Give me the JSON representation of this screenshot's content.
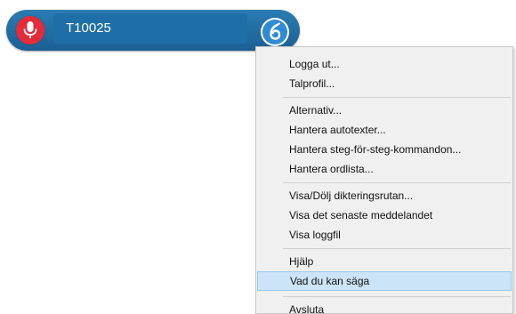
{
  "dictation_bar": {
    "user_name": "T10025",
    "mic_icon": "microphone-icon",
    "menu_icon": "dragon-logo-icon",
    "colors": {
      "bar": "#1e6fa8",
      "mic": "#e52b3a",
      "menu_button": "#2f8bd3"
    }
  },
  "menu": {
    "items": [
      {
        "label": "Logga ut..."
      },
      {
        "label": "Talprofil..."
      },
      {
        "label": "Alternativ..."
      },
      {
        "label": "Hantera autotexter..."
      },
      {
        "label": "Hantera steg-för-steg-kommandon..."
      },
      {
        "label": "Hantera ordlista..."
      },
      {
        "label": "Visa/Dölj dikteringsrutan..."
      },
      {
        "label": "Visa det senaste meddelandet"
      },
      {
        "label": "Visa loggfil"
      },
      {
        "label": "Hjälp"
      },
      {
        "label": "Vad du kan säga",
        "highlighted": true
      },
      {
        "label": "Avsluta"
      }
    ],
    "colors": {
      "background": "#f0f0f0",
      "highlight": "#cce4f7"
    }
  }
}
